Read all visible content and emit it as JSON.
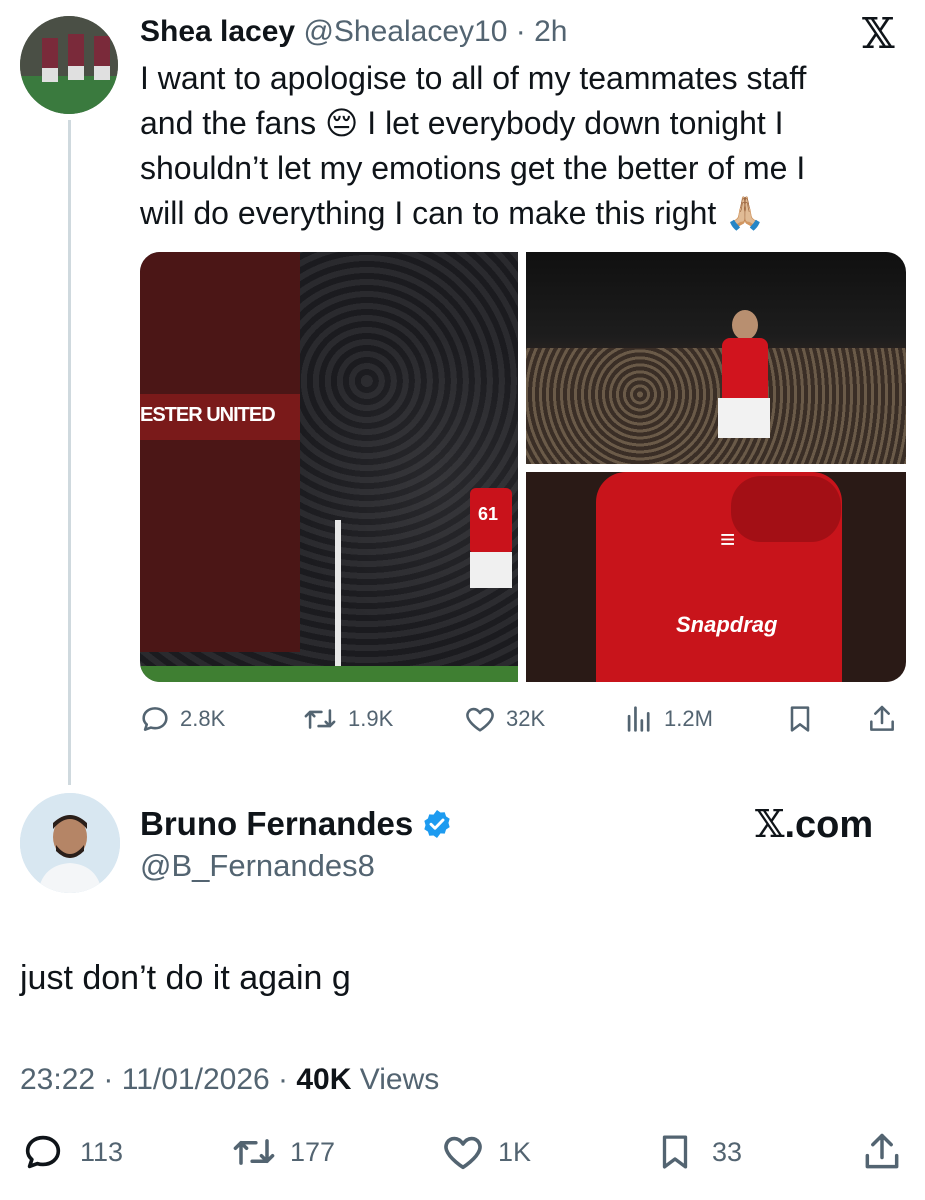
{
  "post1": {
    "display_name": "Shea lacey",
    "handle": "@Shealacey10",
    "separator": "·",
    "time": "2h",
    "platform_logo": "𝕏",
    "text_lines": [
      "I want to apologise to all of my teammates staff",
      "and the fans 😔 I let everybody down tonight I",
      "shouldn’t let my emotions get the better of me I",
      "will do everything I can to make this right 🙏🏼"
    ],
    "media_left_text": "ESTER UNITED",
    "media_left_number": "61",
    "media_br_text": "Snapdrag",
    "actions": {
      "replies": "2.8K",
      "reposts": "1.9K",
      "likes": "32K",
      "views": "1.2M"
    }
  },
  "post2": {
    "display_name": "Bruno Fernandes",
    "handle": "@B_Fernandes8",
    "site_x": "𝕏",
    "site_suffix": ".com",
    "text": "just don’t do it again g",
    "meta": {
      "time": "23:22",
      "sep1": "·",
      "date": "11/01/2026",
      "sep2": "·",
      "views_count": "40K",
      "views_label": "Views"
    },
    "actions": {
      "replies": "113",
      "reposts": "177",
      "likes": "1K",
      "bookmarks": "33"
    }
  },
  "colors": {
    "text": "#0f1419",
    "muted": "#536471",
    "verified": "#1d9bf0",
    "thread_line": "#cfd9de"
  },
  "icons": [
    "reply-icon",
    "repost-icon",
    "like-icon",
    "views-icon",
    "bookmark-icon",
    "share-icon",
    "verified-badge-icon",
    "x-logo-icon"
  ]
}
